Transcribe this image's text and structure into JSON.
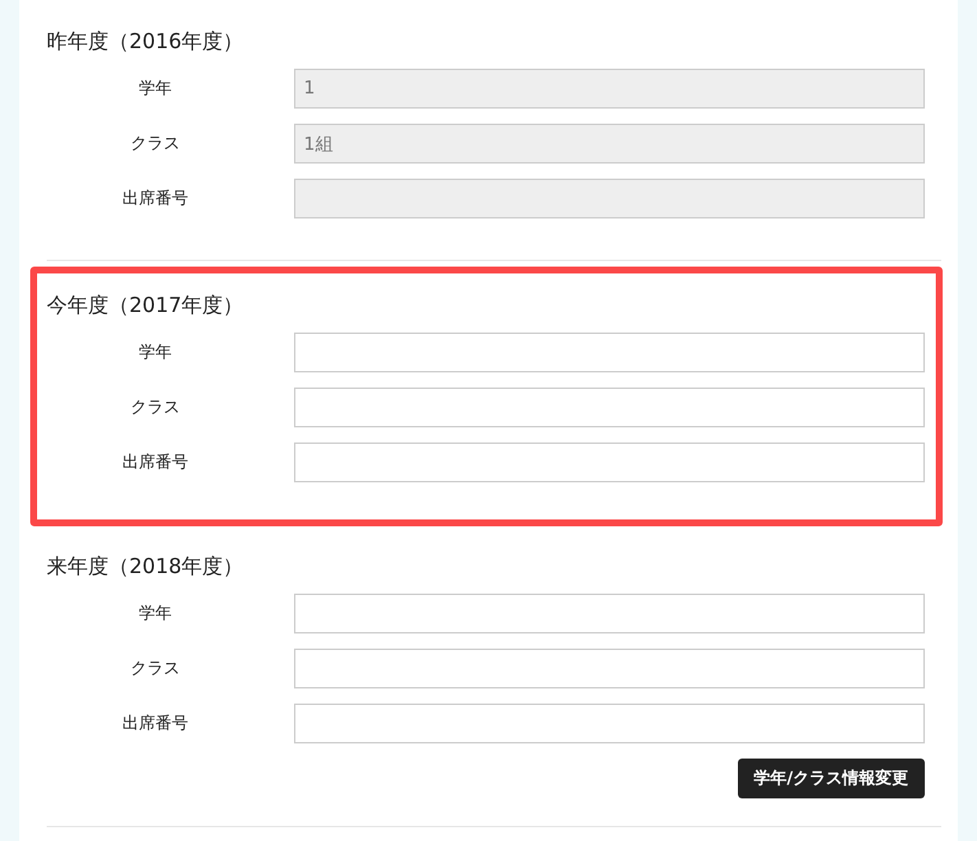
{
  "sections": [
    {
      "title": "昨年度（2016年度）",
      "highlighted": false,
      "fields": [
        {
          "label": "学年",
          "value": "1",
          "disabled": true
        },
        {
          "label": "クラス",
          "value": "1組",
          "disabled": true
        },
        {
          "label": "出席番号",
          "disabled": true
        }
      ]
    },
    {
      "title": "今年度（2017年度）",
      "highlighted": true,
      "fields": [
        {
          "label": "学年",
          "disabled": false
        },
        {
          "label": "クラス",
          "disabled": false
        },
        {
          "label": "出席番号",
          "disabled": false
        }
      ]
    },
    {
      "title": "来年度（2018年度）",
      "highlighted": false,
      "fields": [
        {
          "label": "学年",
          "disabled": false
        },
        {
          "label": "クラス",
          "disabled": false
        },
        {
          "label": "出席番号",
          "disabled": false
        }
      ]
    }
  ],
  "submit_button": "学年/クラス情報変更"
}
